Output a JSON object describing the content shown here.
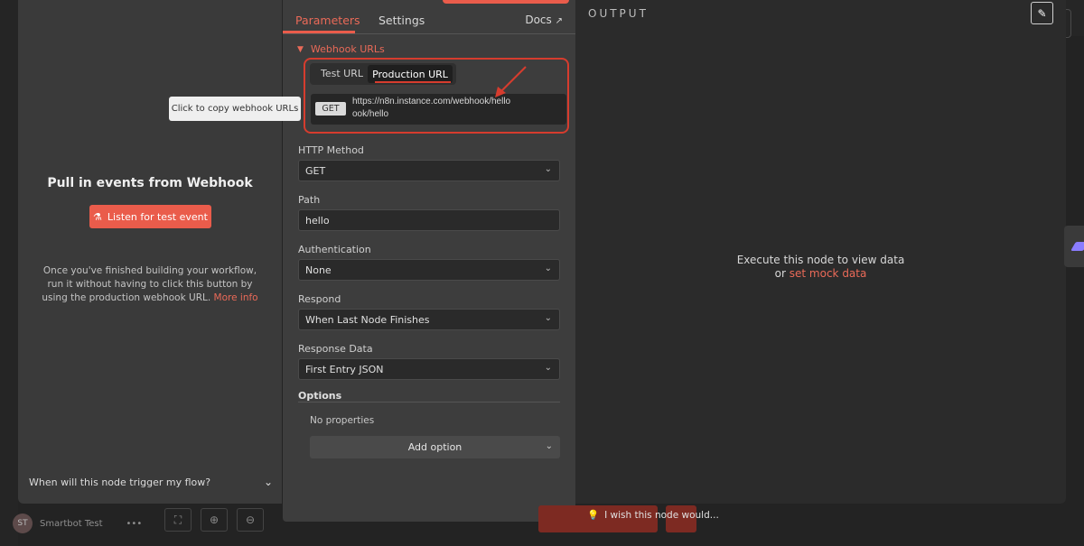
{
  "input_panel": {
    "title": "Pull in events from Webhook",
    "listen_button": "Listen for test event",
    "help_text": "Once you've finished building your workflow, run it without having to click this button by using the production webhook URL.",
    "help_link": "More info",
    "trigger_question": "When will this node trigger my flow?"
  },
  "tooltip": "Click to copy webhook URLs",
  "params": {
    "tabs": [
      "Parameters",
      "Settings"
    ],
    "docs_label": "Docs",
    "section_title": "Webhook URLs",
    "url_tabs": [
      "Test URL",
      "Production URL"
    ],
    "method_badge": "GET",
    "url_line1": "https://n8n.instance.com/webhook/hello",
    "url_line2": "ook/hello",
    "fields": [
      {
        "label": "HTTP Method",
        "value": "GET"
      },
      {
        "label": "Path",
        "value": "hello"
      },
      {
        "label": "Authentication",
        "value": "None"
      },
      {
        "label": "Respond",
        "value": "When Last Node Finishes"
      },
      {
        "label": "Response Data",
        "value": "First Entry JSON"
      }
    ],
    "options_label": "Options",
    "no_properties": "No properties",
    "add_option": "Add option"
  },
  "output": {
    "title": "OUTPUT",
    "exec_line1": "Execute this node to view data",
    "exec_or": "or",
    "mock_link": "set mock data"
  },
  "bottom": {
    "user_initials": "ST",
    "user_name": "Smartbot Test",
    "wish_text": "I wish this node would..."
  },
  "colors": {
    "accent": "#ea5c4b",
    "highlight_box": "#d63c2e"
  }
}
